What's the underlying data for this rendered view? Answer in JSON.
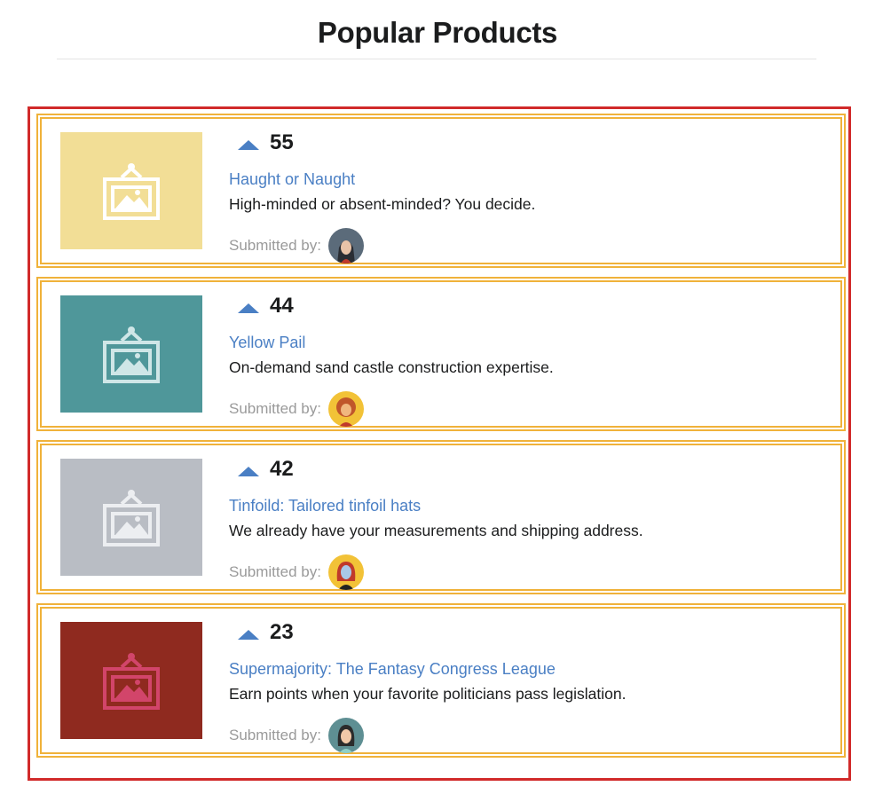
{
  "page": {
    "title": "Popular Products"
  },
  "colors": {
    "list_border": "#d12a2a",
    "item_border": "#f0b23a",
    "link": "#4a7fc4",
    "upvote": "#4a7fc4"
  },
  "products": [
    {
      "votes": "55",
      "title": "Haught or Naught",
      "description": "High-minded or absent-minded? You decide.",
      "submitted_label": "Submitted by:",
      "image_bg": "#f2de96",
      "image_icon_color": "#ffffff",
      "avatar_bg": "#5b6b7a"
    },
    {
      "votes": "44",
      "title": "Yellow Pail",
      "description": "On-demand sand castle construction expertise.",
      "submitted_label": "Submitted by:",
      "image_bg": "#4f979a",
      "image_icon_color": "#cfe6e7",
      "avatar_bg": "#f2c237"
    },
    {
      "votes": "42",
      "title": "Tinfoild: Tailored tinfoil hats",
      "description": "We already have your measurements and shipping address.",
      "submitted_label": "Submitted by:",
      "image_bg": "#b9bdc4",
      "image_icon_color": "#eceef1",
      "avatar_bg": "#f2c237"
    },
    {
      "votes": "23",
      "title": "Supermajority: The Fantasy Congress League",
      "description": "Earn points when your favorite politicians pass legislation.",
      "submitted_label": "Submitted by:",
      "image_bg": "#8f2a1f",
      "image_icon_color": "#d2456a",
      "avatar_bg": "#5e8f93"
    }
  ]
}
